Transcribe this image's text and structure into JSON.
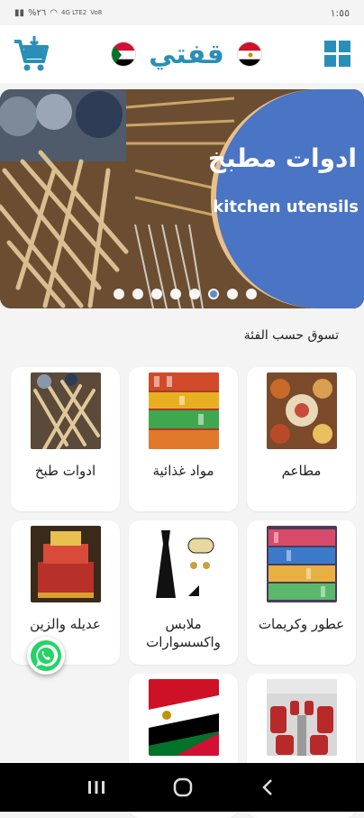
{
  "status": {
    "time": "١:٥٥",
    "battery": "%٢٦",
    "network": "4G LTE2",
    "volte": "Vo8"
  },
  "header": {
    "logo_text": "قفتي",
    "menu_icon": "grid-icon",
    "cart_icon": "cart-icon"
  },
  "banner": {
    "title_ar": "ادوات مطبخ",
    "title_en": "kitchen utensils",
    "slide_count": 8,
    "active_slide": 6
  },
  "section": {
    "title": "تسوق حسب الفئة"
  },
  "categories": [
    {
      "label": "ادوات طبخ",
      "image": "wooden-utensils"
    },
    {
      "label": "مواد غذائية",
      "image": "grocery-shelves"
    },
    {
      "label": "مطاعم",
      "image": "restaurant-food"
    },
    {
      "label": "عديله والزين",
      "image": "wedding-gift-tray"
    },
    {
      "label": "ملابس واكسسوارات",
      "image": "dress-accessories"
    },
    {
      "label": "عطور وكريمات",
      "image": "perfume-shelves"
    },
    {
      "label": "",
      "image": "egypt-sudan-flags"
    },
    {
      "label": "",
      "image": "bus-interior"
    }
  ],
  "colors": {
    "brand": "#2a8fb8",
    "banner_blue": "#4a74c4",
    "whatsapp": "#25d366"
  }
}
